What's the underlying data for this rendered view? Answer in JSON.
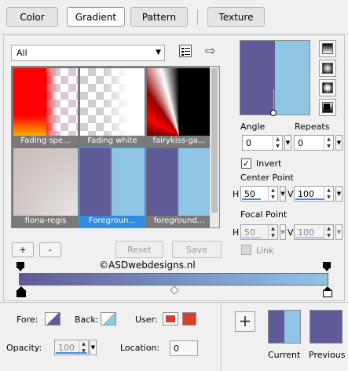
{
  "tabs": [
    {
      "label": "Color"
    },
    {
      "label": "Gradient"
    },
    {
      "label": "Pattern"
    },
    {
      "label": "Texture"
    }
  ],
  "active_tab": "Gradient",
  "category": {
    "value": "All"
  },
  "thumbnails": [
    {
      "label": "Fading spe..."
    },
    {
      "label": "Fading white"
    },
    {
      "label": "fairykiss-ga..."
    },
    {
      "label": "fiona-regis"
    },
    {
      "label": "Foregroun...",
      "selected": true
    },
    {
      "label": "foreground..."
    }
  ],
  "buttons": {
    "add": "+",
    "remove": "-",
    "reset": "Reset",
    "save": "Save"
  },
  "angle": {
    "label": "Angle",
    "value": "0"
  },
  "repeats": {
    "label": "Repeats",
    "value": "0"
  },
  "invert": {
    "label": "Invert",
    "checked": true
  },
  "center_point": {
    "label": "Center Point",
    "h_label": "H",
    "h_value": "50",
    "v_label": "V",
    "v_value": "100"
  },
  "focal_point": {
    "label": "Focal Point",
    "h_label": "H",
    "h_value": "50",
    "v_label": "V",
    "v_value": "100"
  },
  "link": {
    "label": "Link",
    "checked": false
  },
  "watermark": "©ASDwebdesigns.nl",
  "bottom": {
    "fore_label": "Fore:",
    "back_label": "Back:",
    "user_label": "User:",
    "opacity_label": "Opacity:",
    "opacity_value": "100",
    "location_label": "Location:",
    "location_value": "0",
    "current_label": "Current",
    "previous_label": "Previous"
  },
  "colors": {
    "gradient_start": "#5f5a98",
    "gradient_end": "#8fc6e6",
    "selection": "#2f8be0",
    "user_swatch": "#d9402c"
  }
}
